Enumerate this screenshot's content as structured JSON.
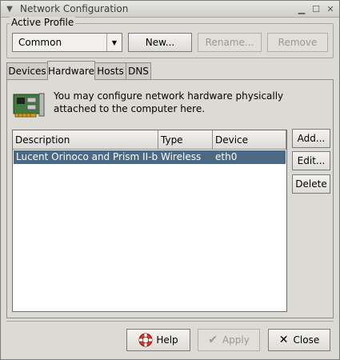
{
  "window": {
    "title": "Network Configuration"
  },
  "profile": {
    "label": "Active Profile",
    "selected": "Common",
    "new_label": "New...",
    "rename_label": "Rename...",
    "remove_label": "Remove"
  },
  "tabs": [
    {
      "label": "Devices"
    },
    {
      "label": "Hardware"
    },
    {
      "label": "Hosts"
    },
    {
      "label": "DNS"
    }
  ],
  "hardware": {
    "info": "You may configure network hardware physically attached to the computer here.",
    "columns": [
      "Description",
      "Type",
      "Device"
    ],
    "rows": [
      {
        "description": "Lucent Orinoco and Prism II-bas",
        "type": "Wireless",
        "device": "eth0"
      }
    ],
    "add_label": "Add...",
    "edit_label": "Edit...",
    "delete_label": "Delete"
  },
  "footer": {
    "help_label": "Help",
    "apply_label": "Apply",
    "close_label": "Close"
  },
  "icons": {
    "window_menu": "chevron-down-icon",
    "minimize": "minimize-icon",
    "maximize": "maximize-icon",
    "close": "close-icon",
    "hardware": "network-card-icon",
    "help": "lifebuoy-icon",
    "apply": "checkmark-icon",
    "close_button": "x-icon"
  },
  "colors": {
    "selection": "#4b6983",
    "window_bg": "#dcdad5"
  }
}
